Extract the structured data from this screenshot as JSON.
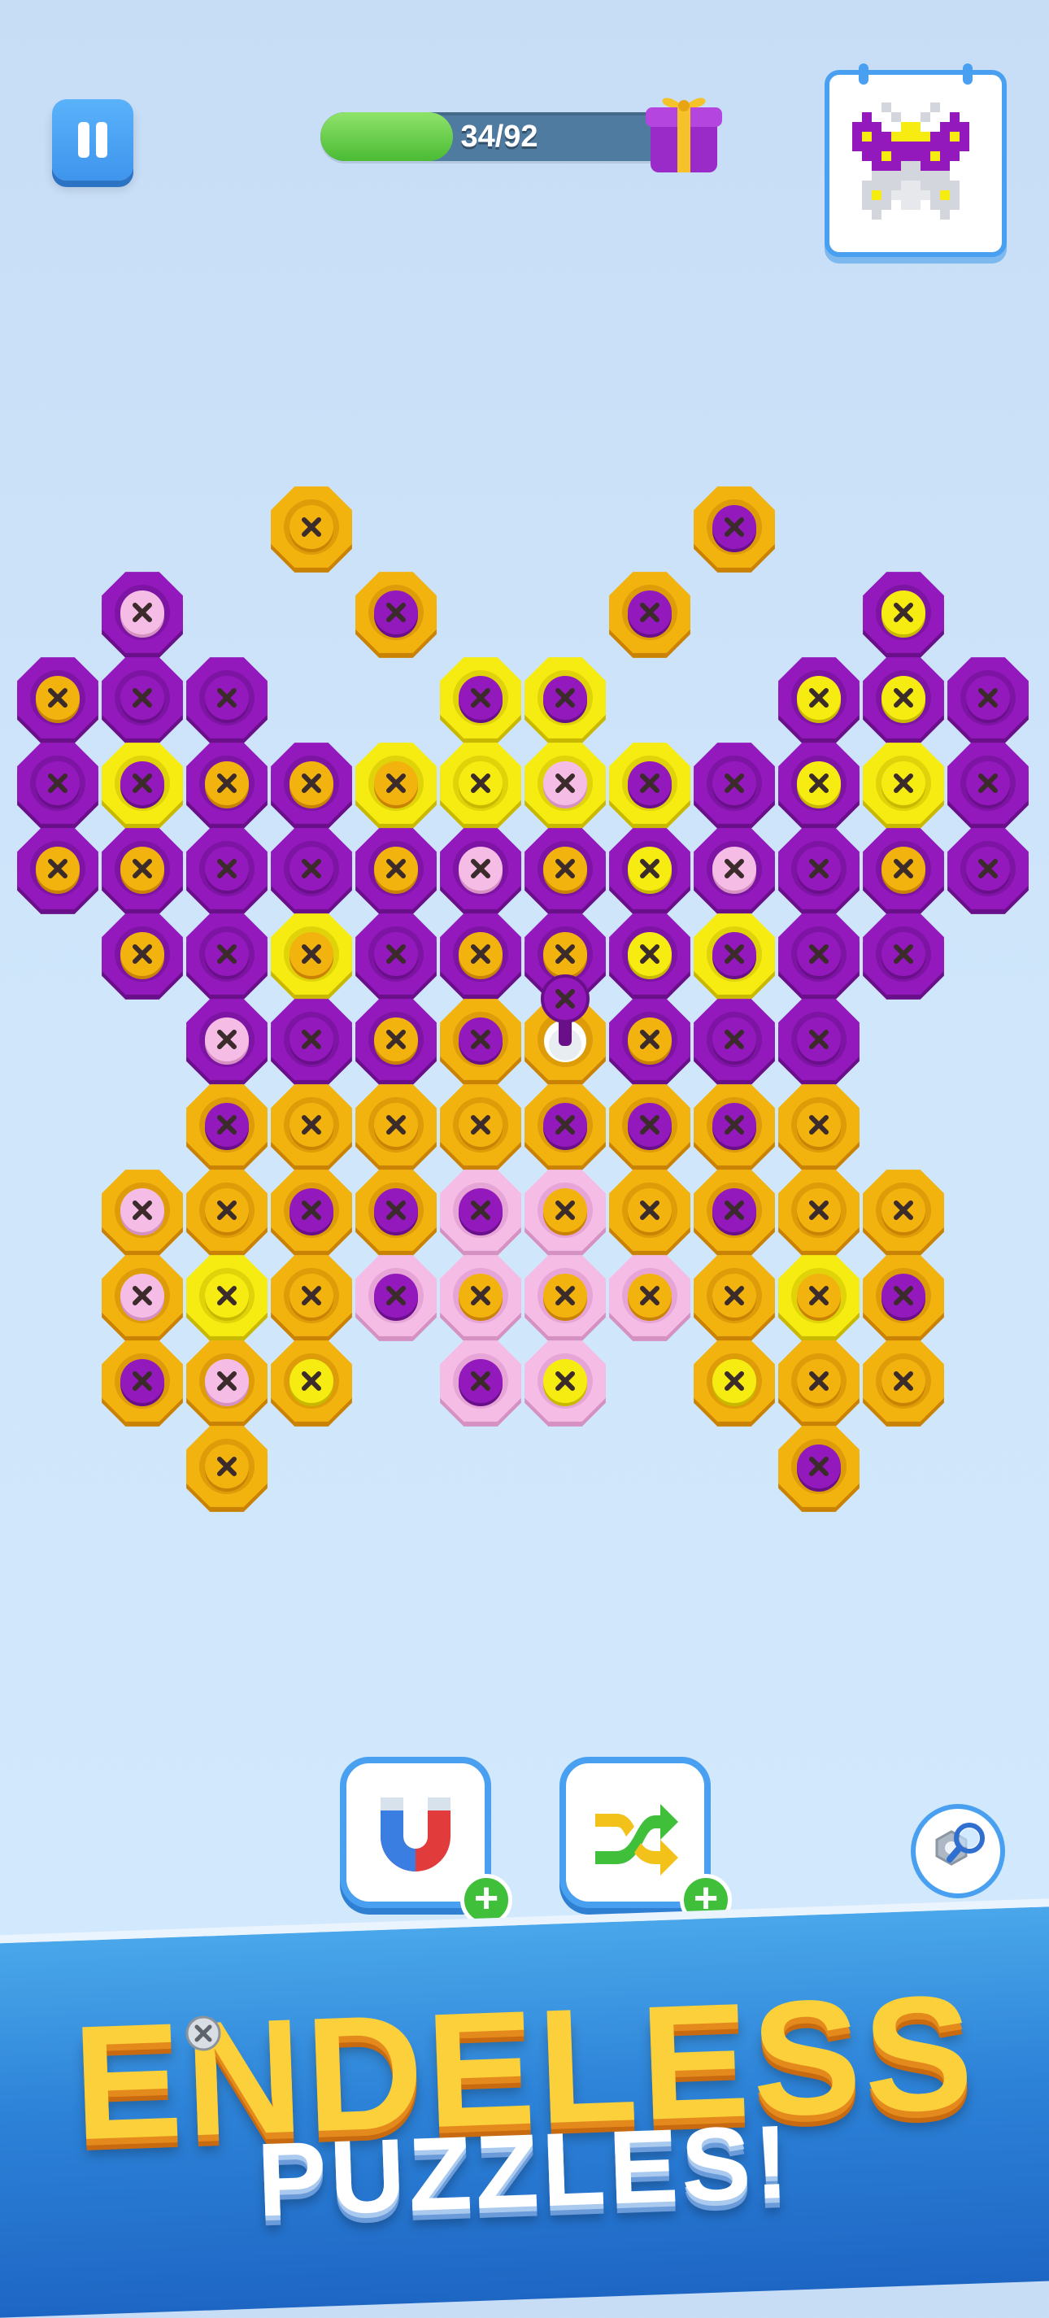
{
  "colors": {
    "purple": "#8f18b5",
    "orange": "#f2b20c",
    "yellow": "#f4ea10",
    "pink": "#f3b9e3",
    "accent_blue": "#4aa0f0",
    "plus_green": "#3fbf3a"
  },
  "header": {
    "pause_icon": "pause-icon",
    "progress_text": "34/92",
    "progress_fraction": 0.3696,
    "reward_icon": "gift-icon",
    "preview_icon": "butterfly-target-preview-icon"
  },
  "board": {
    "nuts": [
      {
        "r": 0,
        "c": 3,
        "outer": "orange",
        "inner": "orange"
      },
      {
        "r": 0,
        "c": 8,
        "outer": "orange",
        "inner": "purple"
      },
      {
        "r": 1,
        "c": 1,
        "outer": "purple",
        "inner": "pink"
      },
      {
        "r": 1,
        "c": 4,
        "outer": "orange",
        "inner": "purple"
      },
      {
        "r": 1,
        "c": 7,
        "outer": "orange",
        "inner": "purple"
      },
      {
        "r": 1,
        "c": 10,
        "outer": "purple",
        "inner": "yellow"
      },
      {
        "r": 2,
        "c": 0,
        "outer": "purple",
        "inner": "orange"
      },
      {
        "r": 2,
        "c": 1,
        "outer": "purple",
        "inner": "purple"
      },
      {
        "r": 2,
        "c": 2,
        "outer": "purple",
        "inner": "purple"
      },
      {
        "r": 2,
        "c": 5,
        "outer": "yellow",
        "inner": "purple"
      },
      {
        "r": 2,
        "c": 6,
        "outer": "yellow",
        "inner": "purple"
      },
      {
        "r": 2,
        "c": 9,
        "outer": "purple",
        "inner": "yellow"
      },
      {
        "r": 2,
        "c": 10,
        "outer": "purple",
        "inner": "yellow"
      },
      {
        "r": 2,
        "c": 11,
        "outer": "purple",
        "inner": "purple"
      },
      {
        "r": 3,
        "c": 0,
        "outer": "purple",
        "inner": "purple"
      },
      {
        "r": 3,
        "c": 1,
        "outer": "yellow",
        "inner": "purple"
      },
      {
        "r": 3,
        "c": 2,
        "outer": "purple",
        "inner": "orange"
      },
      {
        "r": 3,
        "c": 3,
        "outer": "purple",
        "inner": "orange"
      },
      {
        "r": 3,
        "c": 4,
        "outer": "yellow",
        "inner": "orange"
      },
      {
        "r": 3,
        "c": 5,
        "outer": "yellow",
        "inner": "yellow"
      },
      {
        "r": 3,
        "c": 6,
        "outer": "yellow",
        "inner": "pink"
      },
      {
        "r": 3,
        "c": 7,
        "outer": "yellow",
        "inner": "purple"
      },
      {
        "r": 3,
        "c": 8,
        "outer": "purple",
        "inner": "purple"
      },
      {
        "r": 3,
        "c": 9,
        "outer": "purple",
        "inner": "yellow"
      },
      {
        "r": 3,
        "c": 10,
        "outer": "yellow",
        "inner": "yellow"
      },
      {
        "r": 3,
        "c": 11,
        "outer": "purple",
        "inner": "purple"
      },
      {
        "r": 4,
        "c": 0,
        "outer": "purple",
        "inner": "orange"
      },
      {
        "r": 4,
        "c": 1,
        "outer": "purple",
        "inner": "orange"
      },
      {
        "r": 4,
        "c": 2,
        "outer": "purple",
        "inner": "purple"
      },
      {
        "r": 4,
        "c": 3,
        "outer": "purple",
        "inner": "purple"
      },
      {
        "r": 4,
        "c": 4,
        "outer": "purple",
        "inner": "orange"
      },
      {
        "r": 4,
        "c": 5,
        "outer": "purple",
        "inner": "pink"
      },
      {
        "r": 4,
        "c": 6,
        "outer": "purple",
        "inner": "orange"
      },
      {
        "r": 4,
        "c": 7,
        "outer": "purple",
        "inner": "yellow"
      },
      {
        "r": 4,
        "c": 8,
        "outer": "purple",
        "inner": "pink"
      },
      {
        "r": 4,
        "c": 9,
        "outer": "purple",
        "inner": "purple"
      },
      {
        "r": 4,
        "c": 10,
        "outer": "purple",
        "inner": "orange"
      },
      {
        "r": 4,
        "c": 11,
        "outer": "purple",
        "inner": "purple"
      },
      {
        "r": 5,
        "c": 1,
        "outer": "purple",
        "inner": "orange"
      },
      {
        "r": 5,
        "c": 2,
        "outer": "purple",
        "inner": "purple"
      },
      {
        "r": 5,
        "c": 3,
        "outer": "yellow",
        "inner": "orange"
      },
      {
        "r": 5,
        "c": 4,
        "outer": "purple",
        "inner": "purple"
      },
      {
        "r": 5,
        "c": 5,
        "outer": "purple",
        "inner": "orange"
      },
      {
        "r": 5,
        "c": 6,
        "outer": "purple",
        "inner": "orange"
      },
      {
        "r": 5,
        "c": 7,
        "outer": "purple",
        "inner": "yellow"
      },
      {
        "r": 5,
        "c": 8,
        "outer": "yellow",
        "inner": "purple"
      },
      {
        "r": 5,
        "c": 9,
        "outer": "purple",
        "inner": "purple"
      },
      {
        "r": 5,
        "c": 10,
        "outer": "purple",
        "inner": "purple"
      },
      {
        "r": 6,
        "c": 2,
        "outer": "purple",
        "inner": "pink"
      },
      {
        "r": 6,
        "c": 3,
        "outer": "purple",
        "inner": "purple"
      },
      {
        "r": 6,
        "c": 4,
        "outer": "purple",
        "inner": "orange"
      },
      {
        "r": 6,
        "c": 5,
        "outer": "orange",
        "inner": "purple"
      },
      {
        "r": 6,
        "c": 6,
        "outer": "orange",
        "inner": "empty"
      },
      {
        "r": 6,
        "c": 7,
        "outer": "purple",
        "inner": "orange"
      },
      {
        "r": 6,
        "c": 8,
        "outer": "purple",
        "inner": "purple"
      },
      {
        "r": 6,
        "c": 9,
        "outer": "purple",
        "inner": "purple"
      },
      {
        "r": 7,
        "c": 2,
        "outer": "orange",
        "inner": "purple"
      },
      {
        "r": 7,
        "c": 3,
        "outer": "orange",
        "inner": "orange"
      },
      {
        "r": 7,
        "c": 4,
        "outer": "orange",
        "inner": "orange"
      },
      {
        "r": 7,
        "c": 5,
        "outer": "orange",
        "inner": "orange"
      },
      {
        "r": 7,
        "c": 6,
        "outer": "orange",
        "inner": "purple"
      },
      {
        "r": 7,
        "c": 7,
        "outer": "orange",
        "inner": "purple"
      },
      {
        "r": 7,
        "c": 8,
        "outer": "orange",
        "inner": "purple"
      },
      {
        "r": 7,
        "c": 9,
        "outer": "orange",
        "inner": "orange"
      },
      {
        "r": 8,
        "c": 1,
        "outer": "orange",
        "inner": "pink"
      },
      {
        "r": 8,
        "c": 2,
        "outer": "orange",
        "inner": "orange"
      },
      {
        "r": 8,
        "c": 3,
        "outer": "orange",
        "inner": "purple"
      },
      {
        "r": 8,
        "c": 4,
        "outer": "orange",
        "inner": "purple"
      },
      {
        "r": 8,
        "c": 5,
        "outer": "pink",
        "inner": "purple"
      },
      {
        "r": 8,
        "c": 6,
        "outer": "pink",
        "inner": "orange"
      },
      {
        "r": 8,
        "c": 7,
        "outer": "orange",
        "inner": "orange"
      },
      {
        "r": 8,
        "c": 8,
        "outer": "orange",
        "inner": "purple"
      },
      {
        "r": 8,
        "c": 9,
        "outer": "orange",
        "inner": "orange"
      },
      {
        "r": 8,
        "c": 10,
        "outer": "orange",
        "inner": "orange"
      },
      {
        "r": 9,
        "c": 1,
        "outer": "orange",
        "inner": "pink"
      },
      {
        "r": 9,
        "c": 2,
        "outer": "yellow",
        "inner": "yellow"
      },
      {
        "r": 9,
        "c": 3,
        "outer": "orange",
        "inner": "orange"
      },
      {
        "r": 9,
        "c": 4,
        "outer": "pink",
        "inner": "purple"
      },
      {
        "r": 9,
        "c": 5,
        "outer": "pink",
        "inner": "orange"
      },
      {
        "r": 9,
        "c": 6,
        "outer": "pink",
        "inner": "orange"
      },
      {
        "r": 9,
        "c": 7,
        "outer": "pink",
        "inner": "orange"
      },
      {
        "r": 9,
        "c": 8,
        "outer": "orange",
        "inner": "orange"
      },
      {
        "r": 9,
        "c": 9,
        "outer": "yellow",
        "inner": "orange"
      },
      {
        "r": 9,
        "c": 10,
        "outer": "orange",
        "inner": "purple"
      },
      {
        "r": 10,
        "c": 1,
        "outer": "orange",
        "inner": "purple"
      },
      {
        "r": 10,
        "c": 2,
        "outer": "orange",
        "inner": "pink"
      },
      {
        "r": 10,
        "c": 3,
        "outer": "orange",
        "inner": "yellow"
      },
      {
        "r": 10,
        "c": 5,
        "outer": "pink",
        "inner": "purple"
      },
      {
        "r": 10,
        "c": 6,
        "outer": "pink",
        "inner": "yellow"
      },
      {
        "r": 10,
        "c": 8,
        "outer": "orange",
        "inner": "yellow"
      },
      {
        "r": 10,
        "c": 9,
        "outer": "orange",
        "inner": "orange"
      },
      {
        "r": 10,
        "c": 10,
        "outer": "orange",
        "inner": "orange"
      },
      {
        "r": 11,
        "c": 2,
        "outer": "orange",
        "inner": "orange"
      },
      {
        "r": 11,
        "c": 9,
        "outer": "orange",
        "inner": "purple"
      }
    ],
    "lifted_screw": {
      "color": "purple",
      "r": 6,
      "c": 6
    }
  },
  "boosters": {
    "magnet_icon": "magnet-icon",
    "magnet_plus": "+",
    "shuffle_icon": "shuffle-icon",
    "shuffle_plus": "+",
    "search_icon": "nut-magnifier-icon"
  },
  "banner": {
    "line1": "ENDELESS",
    "line2": "PUZZLES!"
  }
}
